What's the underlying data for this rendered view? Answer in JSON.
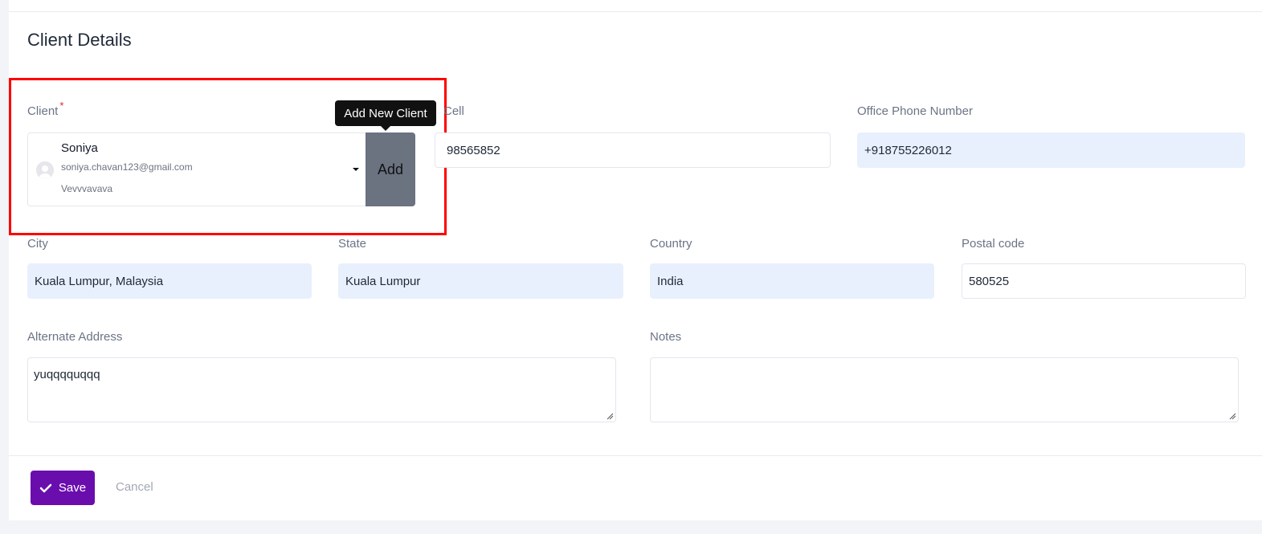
{
  "page": {
    "title": "Client Details"
  },
  "client": {
    "label": "Client",
    "required_marker": "*",
    "selected": {
      "name": "Soniya",
      "email": "soniya.chavan123@gmail.com",
      "company": "Vevvvavava"
    },
    "add_button_label": "Add",
    "tooltip": "Add New Client"
  },
  "cell": {
    "label": "Cell",
    "value": "98565852"
  },
  "office_phone": {
    "label": "Office Phone Number",
    "value": "+918755226012"
  },
  "city": {
    "label": "City",
    "value": "Kuala Lumpur, Malaysia"
  },
  "state": {
    "label": "State",
    "value": "Kuala Lumpur"
  },
  "country": {
    "label": "Country",
    "value": "India"
  },
  "postal_code": {
    "label": "Postal code",
    "value": "580525"
  },
  "alternate_address": {
    "label": "Alternate Address",
    "value": "yuqqqquqqq"
  },
  "notes": {
    "label": "Notes",
    "value": ""
  },
  "actions": {
    "save_label": "Save",
    "cancel_label": "Cancel"
  },
  "colors": {
    "primary": "#6a0dad",
    "add_button": "#6b7280",
    "filled_input": "#e8f0fd",
    "highlight": "#ff0000"
  },
  "icons": {
    "avatar": "user-avatar-icon",
    "save": "check-icon",
    "dropdown": "caret-down-icon",
    "resize": "resize-handle-icon"
  }
}
